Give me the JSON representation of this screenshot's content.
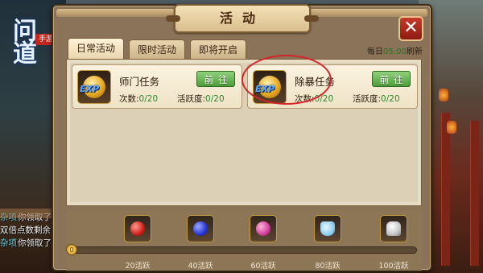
{
  "logo": {
    "text": "问道",
    "badge": "手游"
  },
  "chat": [
    {
      "tag": "杂项",
      "text": "你领取了"
    },
    {
      "tag": "",
      "text": "双倍点数剩余"
    },
    {
      "tag": "杂项",
      "text": "你领取了"
    }
  ],
  "dialog": {
    "title": "活动",
    "close_label": "✕",
    "daily_refresh_prefix": "每日",
    "daily_refresh_time": "05:00",
    "daily_refresh_suffix": "刷新"
  },
  "tabs": [
    {
      "label": "日常活动",
      "active": true
    },
    {
      "label": "限时活动",
      "active": false
    },
    {
      "label": "即将开启",
      "active": false
    }
  ],
  "activities": [
    {
      "name": "师门任务",
      "icon": "exp-coin-icon",
      "count_label": "次数:",
      "count": "0/20",
      "activity_label": "活跃度:",
      "activity": "0/20",
      "button": "前往"
    },
    {
      "name": "除暴任务",
      "icon": "exp-coin-icon",
      "count_label": "次数:",
      "count": "0/20",
      "activity_label": "活跃度:",
      "activity": "0/20",
      "button": "前往"
    }
  ],
  "rewards": {
    "progress": 0,
    "progress_knob_label": "0",
    "items": [
      {
        "label": "20活跃",
        "icon": "red-gem-icon",
        "color": "#d0201a"
      },
      {
        "label": "40活跃",
        "icon": "blue-gem-icon",
        "color": "#2736d6"
      },
      {
        "label": "60活跃",
        "icon": "pink-gems-icon",
        "color": "#d0409a"
      },
      {
        "label": "80活跃",
        "icon": "potion-bottle-icon",
        "color": "#8fd0f0"
      },
      {
        "label": "100活跃",
        "icon": "silver-ingot-icon",
        "color": "#e8e8e8"
      }
    ]
  }
}
